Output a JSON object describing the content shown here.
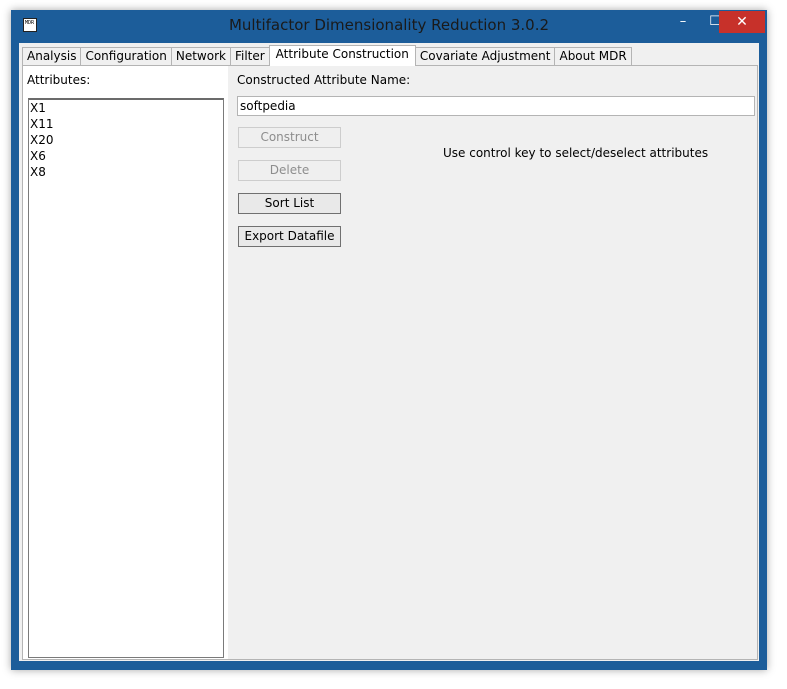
{
  "window": {
    "title": "Multifactor Dimensionality Reduction 3.0.2",
    "icon_text": "MDR",
    "controls": {
      "minimize": "–",
      "maximize": "☐",
      "close": "✕"
    }
  },
  "tabs": [
    {
      "label": "Analysis",
      "active": false
    },
    {
      "label": "Configuration",
      "active": false
    },
    {
      "label": "Network",
      "active": false
    },
    {
      "label": "Filter",
      "active": false
    },
    {
      "label": "Attribute Construction",
      "active": true
    },
    {
      "label": "Covariate Adjustment",
      "active": false
    },
    {
      "label": "About MDR",
      "active": false
    }
  ],
  "attributes": {
    "label": "Attributes:",
    "items": [
      "X1",
      "X11",
      "X20",
      "X6",
      "X8"
    ]
  },
  "construct": {
    "name_label": "Constructed Attribute Name:",
    "name_value": "softpedia",
    "construct_label": "Construct",
    "delete_label": "Delete",
    "sort_label": "Sort List",
    "export_label": "Export Datafile",
    "hint": "Use control key to select/deselect attributes"
  },
  "colors": {
    "title_bar": "#1c5d9a",
    "close_button": "#c7312a",
    "panel_bg": "#f0f0f0"
  }
}
